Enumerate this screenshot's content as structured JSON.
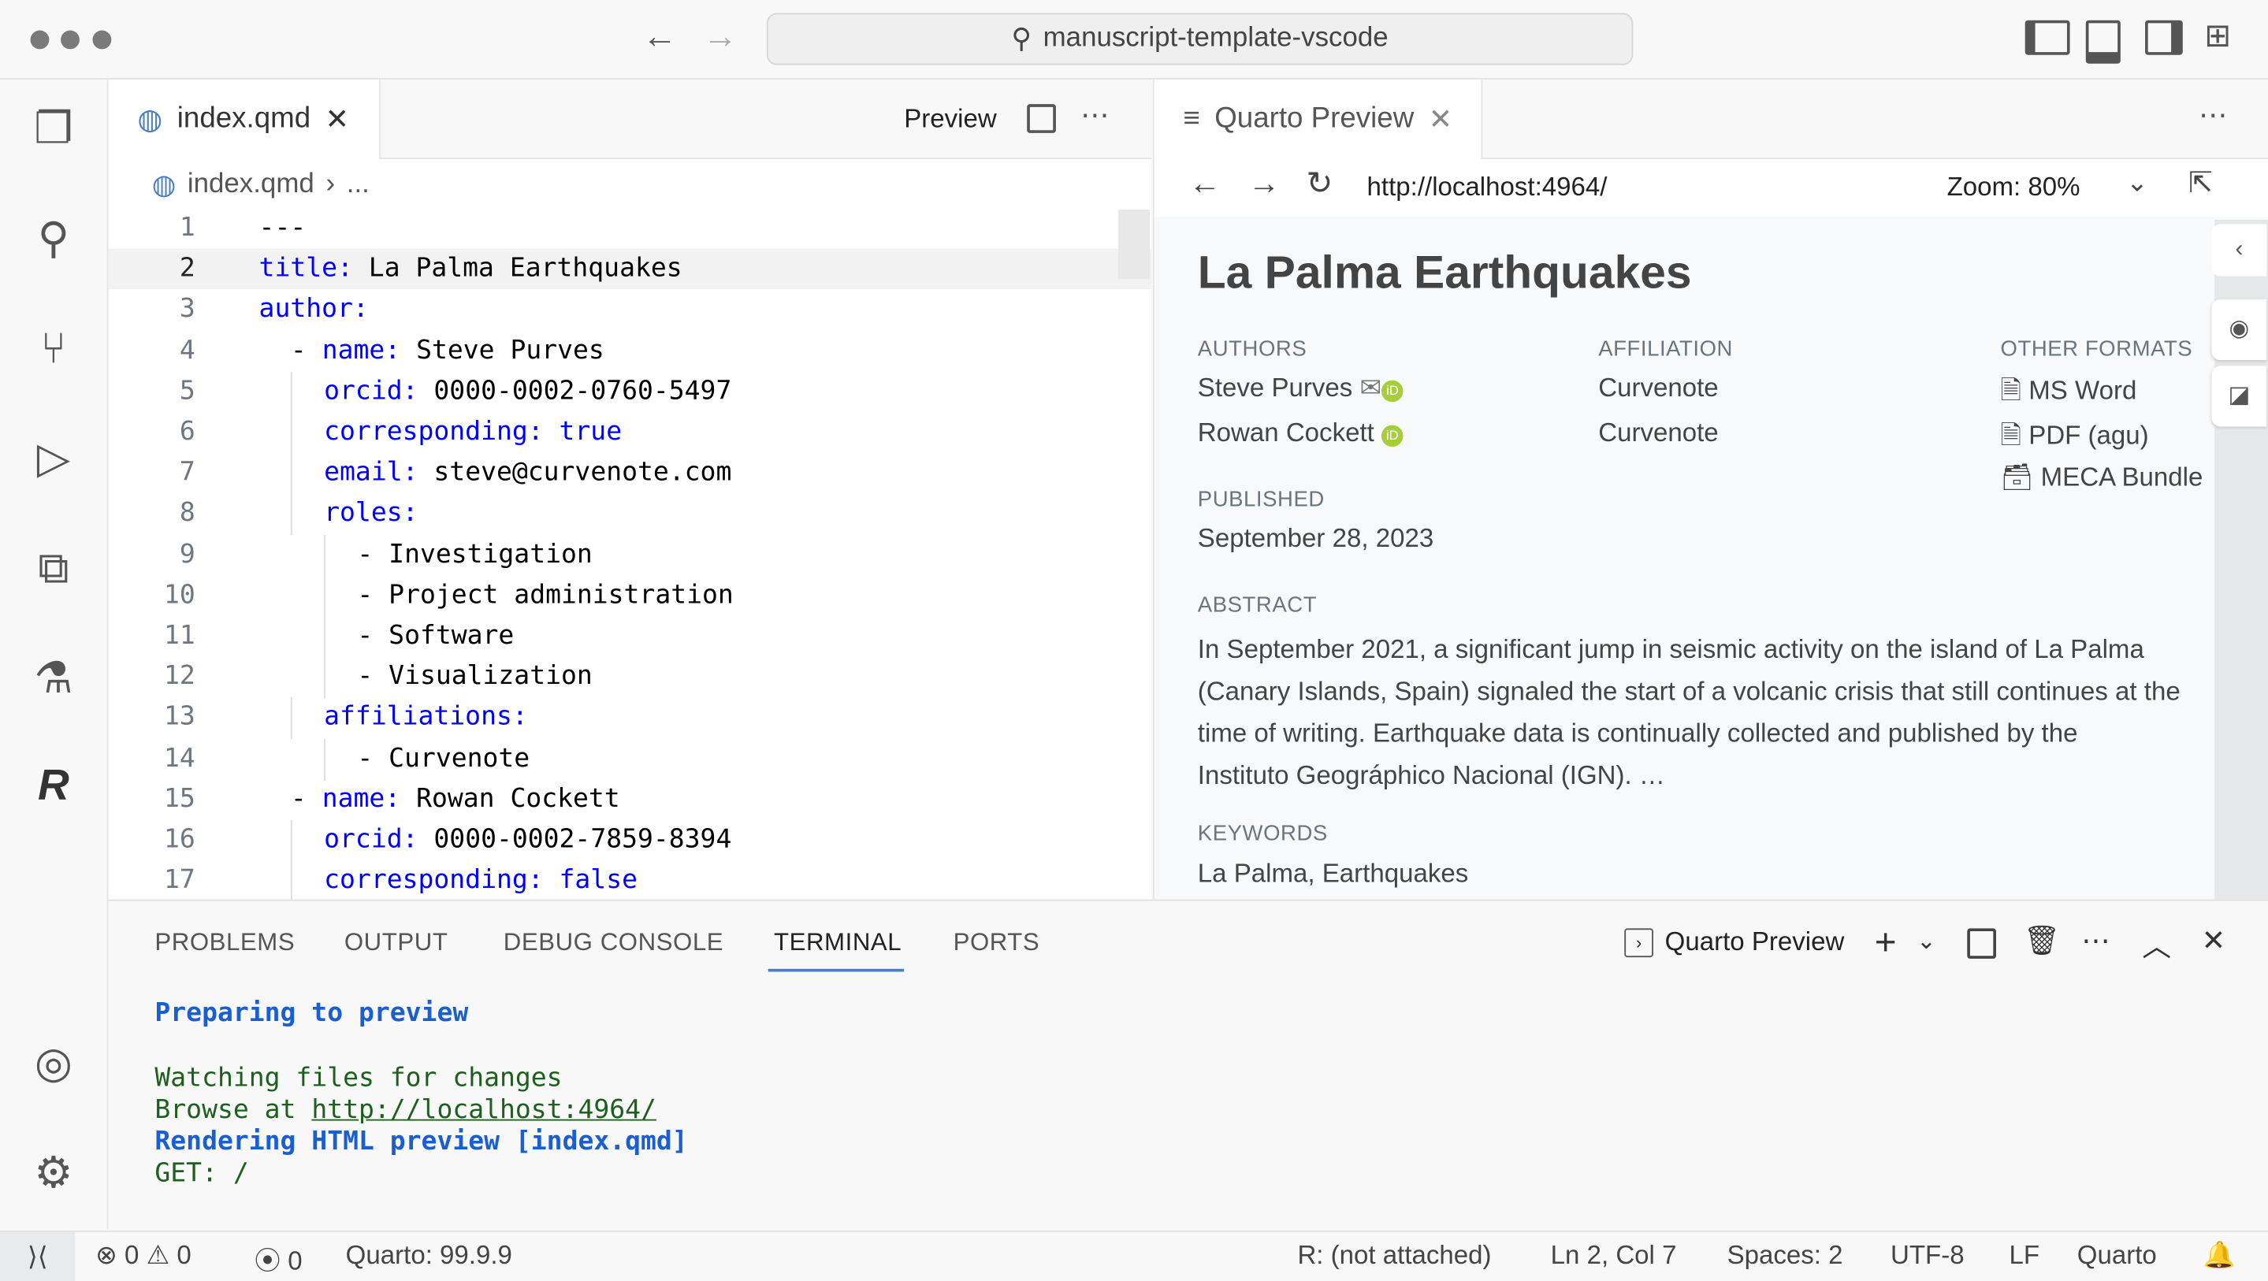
{
  "titlebar": {
    "search": "manuscript-template-vscode"
  },
  "editor": {
    "tab": "index.qmd",
    "preview_button": "Preview",
    "breadcrumb_file": "index.qmd",
    "breadcrumb_more": "...",
    "lines": [
      {
        "n": "1",
        "indent": 0,
        "text": "---"
      },
      {
        "n": "2",
        "indent": 0,
        "key": "title:",
        "value": " La Palma Earthquakes"
      },
      {
        "n": "3",
        "indent": 0,
        "key": "author:"
      },
      {
        "n": "4",
        "indent": 1,
        "dash": "- ",
        "key": "name:",
        "value": " Steve Purves"
      },
      {
        "n": "5",
        "indent": 2,
        "key": "orcid:",
        "value": " 0000-0002-0760-5497"
      },
      {
        "n": "6",
        "indent": 2,
        "key": "corresponding:",
        "bool": " true"
      },
      {
        "n": "7",
        "indent": 2,
        "key": "email:",
        "value": " steve@curvenote.com"
      },
      {
        "n": "8",
        "indent": 2,
        "key": "roles:"
      },
      {
        "n": "9",
        "indent": 3,
        "dash": "- ",
        "value": "Investigation"
      },
      {
        "n": "10",
        "indent": 3,
        "dash": "- ",
        "value": "Project administration"
      },
      {
        "n": "11",
        "indent": 3,
        "dash": "- ",
        "value": "Software"
      },
      {
        "n": "12",
        "indent": 3,
        "dash": "- ",
        "value": "Visualization"
      },
      {
        "n": "13",
        "indent": 2,
        "key": "affiliations:"
      },
      {
        "n": "14",
        "indent": 3,
        "dash": "- ",
        "value": "Curvenote"
      },
      {
        "n": "15",
        "indent": 1,
        "dash": "- ",
        "key": "name:",
        "value": " Rowan Cockett"
      },
      {
        "n": "16",
        "indent": 2,
        "key": "orcid:",
        "value": " 0000-0002-7859-8394"
      },
      {
        "n": "17",
        "indent": 2,
        "key": "corresponding:",
        "bool": " false"
      }
    ]
  },
  "preview": {
    "tab": "Quarto Preview",
    "url": "http://localhost:4964/",
    "zoom": "Zoom: 80%",
    "title": "La Palma Earthquakes",
    "authors_label": "AUTHORS",
    "affiliation_label": "AFFILIATION",
    "formats_label": "OTHER FORMATS",
    "authors": [
      {
        "name": "Steve Purves",
        "affiliation": "Curvenote"
      },
      {
        "name": "Rowan Cockett",
        "affiliation": "Curvenote"
      }
    ],
    "formats": [
      "MS Word",
      "PDF (agu)",
      "MECA Bundle"
    ],
    "published_label": "PUBLISHED",
    "published": "September 28, 2023",
    "abstract_label": "ABSTRACT",
    "abstract_lines": [
      "In September 2021, a significant jump in seismic activity on the island of La Palma",
      "(Canary Islands, Spain) signaled the start of a volcanic crisis that still continues at the",
      "time of writing. Earthquake data is continually collected and published by the",
      "Instituto Geográphico Nacional (IGN). …"
    ],
    "keywords_label": "KEYWORDS",
    "keywords": "La Palma, Earthquakes"
  },
  "panel": {
    "tabs": [
      "PROBLEMS",
      "OUTPUT",
      "DEBUG CONSOLE",
      "TERMINAL",
      "PORTS"
    ],
    "active_tab": "TERMINAL",
    "terminal_name": "Quarto Preview",
    "terminal": {
      "l1": "Preparing to preview",
      "l2": "Watching files for changes",
      "l3a": "Browse at ",
      "l3b": "http://localhost:4964/",
      "l4": "Rendering HTML preview [index.qmd]",
      "l5": "GET: /"
    }
  },
  "status": {
    "errors": "0",
    "warnings": "0",
    "ports": "0",
    "quarto": "Quarto: 99.9.9",
    "r": "R: (not attached)",
    "pos": "Ln 2, Col 7",
    "spaces": "Spaces: 2",
    "enc": "UTF-8",
    "eol": "LF",
    "lang": "Quarto"
  },
  "colors": {
    "yaml_key": "#0000ff",
    "terminal_blue": "#1a5fd0",
    "terminal_green": "#1e5e1e",
    "orcid": "#a6ce39"
  }
}
